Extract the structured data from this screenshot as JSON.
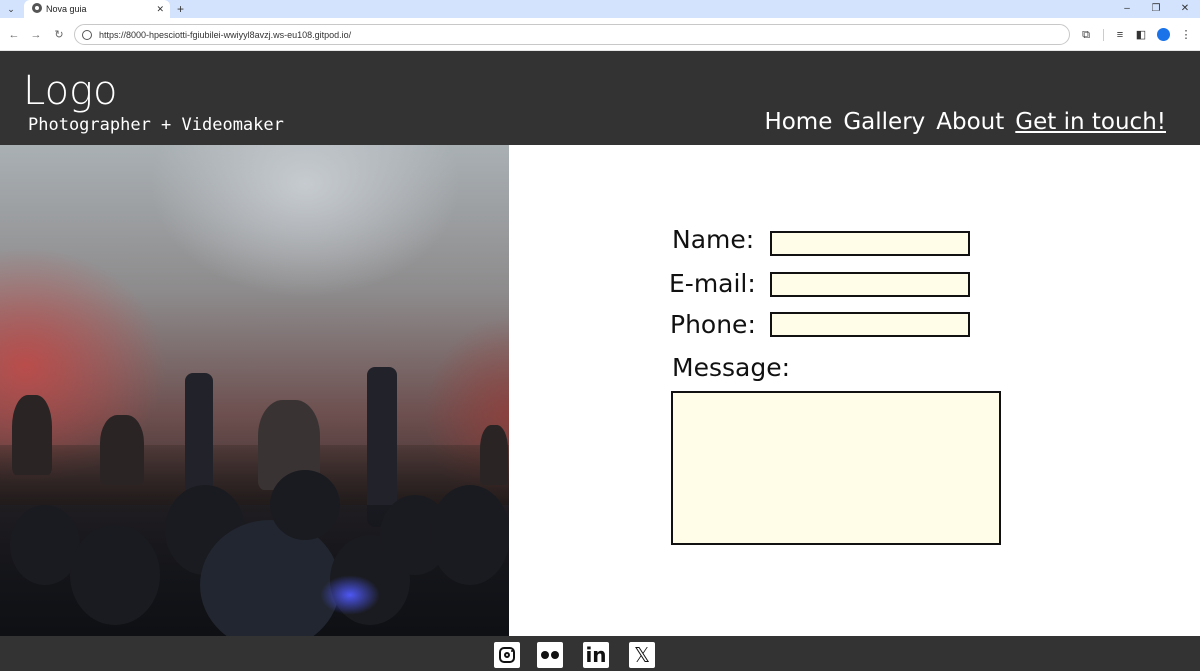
{
  "browser": {
    "tab_title": "Nova guia",
    "url": "https://8000-hpesciotti-fgiubilei-wwiyyl8avzj.ws-eu108.gitpod.io/",
    "icons": {
      "tab_dropdown": "chevron-down-icon",
      "new_tab": "plus-icon",
      "tab_close": "close-icon",
      "back": "arrow-left-icon",
      "forward": "arrow-right-icon",
      "reload": "reload-icon",
      "site_info": "site-info-icon",
      "extensions": "puzzle-icon",
      "reading_list": "reading-list-icon",
      "side_panel": "side-panel-icon",
      "profile": "profile-icon",
      "menu": "kebab-menu-icon",
      "minimize": "minimize-icon",
      "restore": "restore-icon",
      "close_window": "close-icon"
    }
  },
  "site": {
    "logo": "Logo",
    "tagline": "Photographer + Videomaker",
    "nav": [
      {
        "label": "Home",
        "active": false
      },
      {
        "label": "Gallery",
        "active": false
      },
      {
        "label": "About",
        "active": false
      },
      {
        "label": "Get in touch!",
        "active": true
      }
    ],
    "hero_image": "concert-crowd-photo",
    "form": {
      "name_label": "Name:",
      "email_label": "E-mail:",
      "phone_label": "Phone:",
      "message_label": "Message:",
      "name_value": "",
      "email_value": "",
      "phone_value": "",
      "message_value": ""
    },
    "social": [
      {
        "icon": "instagram-icon"
      },
      {
        "icon": "flickr-icon"
      },
      {
        "icon": "linkedin-icon",
        "glyph": "in"
      },
      {
        "icon": "x-icon",
        "glyph": "𝕏"
      }
    ]
  },
  "colors": {
    "header_bg": "#333333",
    "footer_bg": "#333333",
    "input_bg": "#fffde8",
    "tabbar_bg": "#d3e3fd"
  }
}
